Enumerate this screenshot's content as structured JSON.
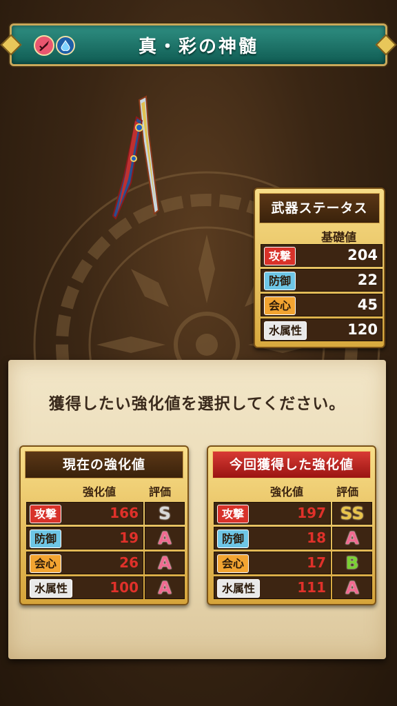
{
  "header": {
    "title": "真・彩の神髄",
    "type_icons": [
      "dagger-icon",
      "water-drop-icon"
    ]
  },
  "weapon_status": {
    "title": "武器ステータス",
    "column": "基礎値",
    "rows": [
      {
        "label": "攻撃",
        "value": "204"
      },
      {
        "label": "防御",
        "value": "22"
      },
      {
        "label": "会心",
        "value": "45"
      },
      {
        "label": "水属性",
        "value": "120"
      }
    ]
  },
  "instruction": "獲得したい強化値を選択してください。",
  "current": {
    "title": "現在の強化値",
    "col_value": "強化値",
    "col_grade": "評価",
    "rows": [
      {
        "label": "攻撃",
        "value": "166",
        "grade": "S"
      },
      {
        "label": "防御",
        "value": "19",
        "grade": "A"
      },
      {
        "label": "会心",
        "value": "26",
        "grade": "A"
      },
      {
        "label": "水属性",
        "value": "100",
        "grade": "A"
      }
    ]
  },
  "obtained": {
    "title": "今回獲得した強化値",
    "col_value": "強化値",
    "col_grade": "評価",
    "rows": [
      {
        "label": "攻撃",
        "value": "197",
        "grade": "SS"
      },
      {
        "label": "防御",
        "value": "18",
        "grade": "A"
      },
      {
        "label": "会心",
        "value": "17",
        "grade": "B"
      },
      {
        "label": "水属性",
        "value": "111",
        "grade": "A"
      }
    ]
  },
  "colors": {
    "attack": "#d8322a",
    "defense": "#6ec6e6",
    "critical": "#f2a431",
    "water": "#e9e9e9",
    "value_red": "#e0312a"
  }
}
